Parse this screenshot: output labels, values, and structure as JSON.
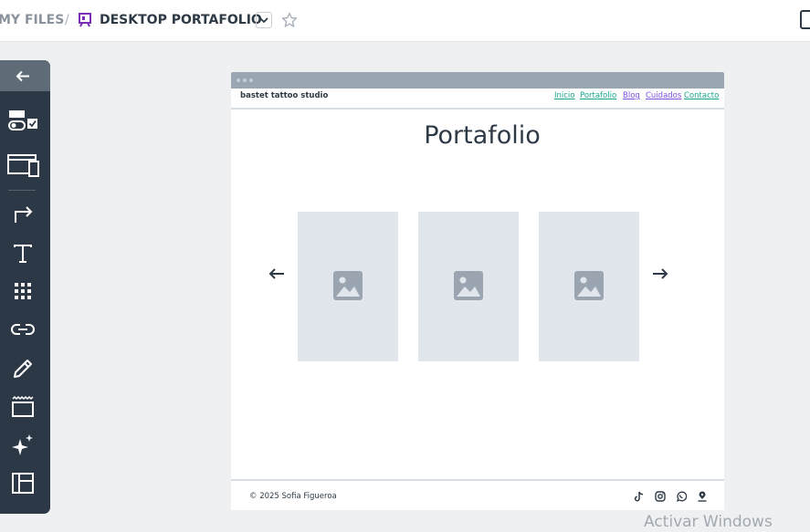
{
  "breadcrumb": {
    "root": "MY FILES",
    "separator": "/",
    "title": "DESKTOP PORTAFOLIO"
  },
  "icons": {
    "prototype": "prototype-board-icon",
    "dropdown": "chevron-down-icon",
    "favorite": "star-icon",
    "right_panel": "panel-icon"
  },
  "toolbar": {
    "items": [
      "back-arrow-icon",
      "components-icon",
      "screens-icon",
      "interaction-arrow-icon",
      "text-icon",
      "grid-icon",
      "link-icon",
      "pencil-icon",
      "container-icon",
      "magic-sparkle-icon",
      "layout-icon"
    ]
  },
  "site": {
    "brand": "bastet tattoo studio",
    "nav": [
      {
        "label": "Inicio",
        "color": "#17a589"
      },
      {
        "label": "Portafolio",
        "color": "#17a589"
      },
      {
        "label": "Blog",
        "color": "#7b4fe0"
      },
      {
        "label": "Cuidados",
        "color": "#7b4fe0"
      },
      {
        "label": "Contacto",
        "color": "#17a589"
      }
    ],
    "heading": "Portafolio",
    "gallery": {
      "prev": "arrow-left-icon",
      "next": "arrow-right-icon",
      "images": [
        "image-placeholder-icon",
        "image-placeholder-icon",
        "image-placeholder-icon"
      ]
    },
    "footer": {
      "copyright": "© 2025 Sofia Figueroa",
      "social": [
        "tiktok-icon",
        "instagram-icon",
        "whatsapp-icon",
        "location-icon"
      ]
    }
  },
  "watermark": "Activar Windows",
  "colors": {
    "toolbar": "#2c3845",
    "toolbar_active": "#5f6b77",
    "canvas": "#eef0f2",
    "placeholder": "#e1e6ec",
    "placeholder_icon": "#9aa5b1"
  }
}
